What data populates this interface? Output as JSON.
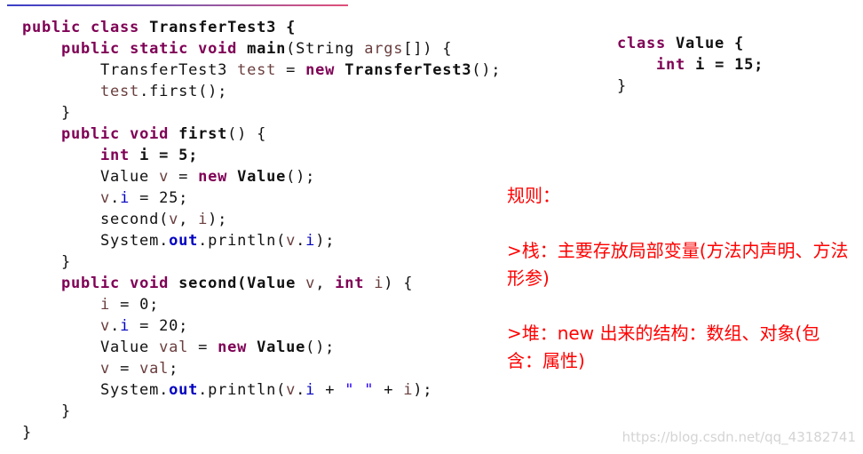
{
  "main_code": [
    [
      [
        "public class ",
        "kw"
      ],
      [
        "TransferTest3 {",
        "b"
      ]
    ],
    [
      [
        "    ",
        ""
      ],
      [
        "public static void ",
        "kw"
      ],
      [
        "main",
        "b"
      ],
      [
        "(String ",
        ""
      ],
      [
        "args",
        "var"
      ],
      [
        "[]) {",
        ""
      ]
    ],
    [
      [
        "        TransferTest3 ",
        ""
      ],
      [
        "test",
        "var"
      ],
      [
        " = ",
        ""
      ],
      [
        "new ",
        "kw"
      ],
      [
        "TransferTest3",
        "b"
      ],
      [
        "();",
        ""
      ]
    ],
    [
      [
        "        ",
        ""
      ],
      [
        "test",
        "var"
      ],
      [
        ".first();",
        ""
      ]
    ],
    [
      [
        "    }",
        ""
      ]
    ],
    [
      [
        "    ",
        ""
      ],
      [
        "public void ",
        "kw"
      ],
      [
        "first",
        "b"
      ],
      [
        "() {",
        ""
      ]
    ],
    [
      [
        "        ",
        ""
      ],
      [
        "int ",
        "kw"
      ],
      [
        "i = 5;",
        "b"
      ]
    ],
    [
      [
        "        Value ",
        ""
      ],
      [
        "v",
        "var"
      ],
      [
        " = ",
        ""
      ],
      [
        "new ",
        "kw"
      ],
      [
        "Value",
        "b"
      ],
      [
        "();",
        ""
      ]
    ],
    [
      [
        "        ",
        ""
      ],
      [
        "v",
        "var"
      ],
      [
        ".",
        ""
      ],
      [
        "i",
        "fld"
      ],
      [
        " = 25;",
        ""
      ]
    ],
    [
      [
        "        second(",
        ""
      ],
      [
        "v",
        "var"
      ],
      [
        ", ",
        ""
      ],
      [
        "i",
        "var"
      ],
      [
        ");",
        ""
      ]
    ],
    [
      [
        "        System.",
        ""
      ],
      [
        "out",
        "fld b"
      ],
      [
        ".println(",
        ""
      ],
      [
        "v",
        "var"
      ],
      [
        ".",
        ""
      ],
      [
        "i",
        "fld"
      ],
      [
        ");",
        ""
      ]
    ],
    [
      [
        "    }",
        ""
      ]
    ],
    [
      [
        "    ",
        ""
      ],
      [
        "public void ",
        "kw"
      ],
      [
        "second",
        "b"
      ],
      [
        "(Value ",
        "b"
      ],
      [
        "v",
        "var"
      ],
      [
        ", ",
        ""
      ],
      [
        "int ",
        "kw"
      ],
      [
        "i",
        "var"
      ],
      [
        ") {",
        ""
      ]
    ],
    [
      [
        "        ",
        ""
      ],
      [
        "i",
        "var"
      ],
      [
        " = 0;",
        ""
      ]
    ],
    [
      [
        "        ",
        ""
      ],
      [
        "v",
        "var"
      ],
      [
        ".",
        ""
      ],
      [
        "i",
        "fld"
      ],
      [
        " = 20;",
        ""
      ]
    ],
    [
      [
        "        Value ",
        ""
      ],
      [
        "val",
        "var"
      ],
      [
        " = ",
        ""
      ],
      [
        "new ",
        "kw"
      ],
      [
        "Value",
        "b"
      ],
      [
        "();",
        ""
      ]
    ],
    [
      [
        "        ",
        ""
      ],
      [
        "v",
        "var"
      ],
      [
        " = ",
        ""
      ],
      [
        "val",
        "var"
      ],
      [
        ";",
        ""
      ]
    ],
    [
      [
        "        System.",
        ""
      ],
      [
        "out",
        "fld b"
      ],
      [
        ".println(",
        ""
      ],
      [
        "v",
        "var"
      ],
      [
        ".",
        ""
      ],
      [
        "i",
        "fld"
      ],
      [
        " + ",
        ""
      ],
      [
        "\" \"",
        "str"
      ],
      [
        " + ",
        ""
      ],
      [
        "i",
        "var"
      ],
      [
        ");",
        ""
      ]
    ],
    [
      [
        "    }",
        ""
      ]
    ],
    [
      [
        "}",
        ""
      ]
    ]
  ],
  "value_code": [
    [
      [
        "class ",
        "kw"
      ],
      [
        "Value {",
        "b"
      ]
    ],
    [
      [
        "    ",
        ""
      ],
      [
        "int ",
        "kw"
      ],
      [
        "i = 15;",
        "b"
      ]
    ],
    [
      [
        "}",
        ""
      ]
    ]
  ],
  "notes": {
    "title": "规则：",
    "stack": ">栈：主要存放局部变量(方法内声明、方法形参)",
    "heap": ">堆：new 出来的结构：数组、对象(包含：属性)"
  },
  "watermark": "https://blog.csdn.net/qq_43182741",
  "colors": {
    "keyword": "#7f0055",
    "variable": "#6a3e3e",
    "field": "#0000c0",
    "string": "#2a00ff",
    "note": "#ff0000"
  }
}
